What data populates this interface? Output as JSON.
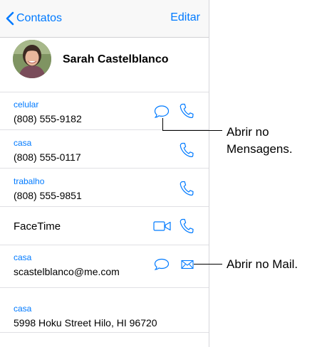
{
  "nav": {
    "back_label": "Contatos",
    "edit_label": "Editar"
  },
  "contact": {
    "name": "Sarah Castelblanco"
  },
  "phones": [
    {
      "label": "celular",
      "number": "(808) 555-9182"
    },
    {
      "label": "casa",
      "number": "(808) 555-0117"
    },
    {
      "label": "trabalho",
      "number": "(808) 555-9851"
    }
  ],
  "facetime": {
    "label": "FaceTime"
  },
  "email": {
    "label": "casa",
    "address": "scastelblanco@me.com"
  },
  "address": {
    "label": "casa",
    "value": "5998 Hoku Street Hilo, HI 96720"
  },
  "callouts": {
    "messages_line1": "Abrir no",
    "messages_line2": "Mensagens.",
    "mail": "Abrir no Mail."
  },
  "colors": {
    "accent": "#007aff",
    "navbar_bg": "#f8f8f8",
    "separator": "#e0e0e4"
  },
  "icons": [
    "chevron-left-icon",
    "message-bubble-icon",
    "phone-icon",
    "video-camera-icon",
    "envelope-icon"
  ]
}
